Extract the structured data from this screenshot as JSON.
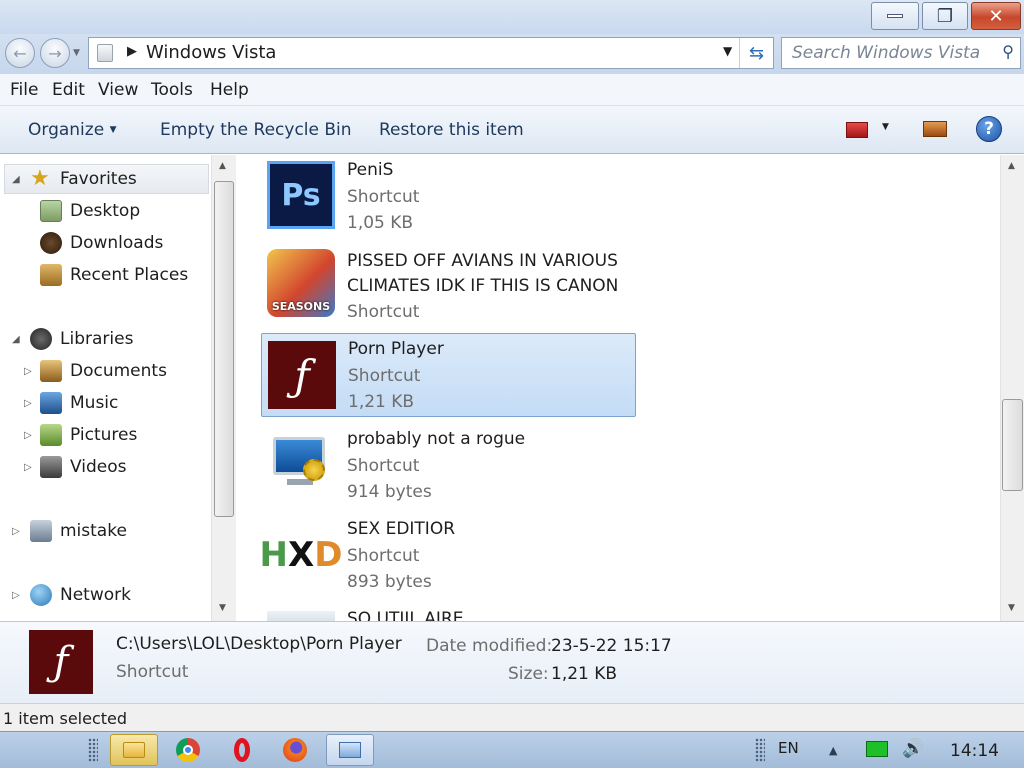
{
  "window": {
    "minimize_glyph": "—",
    "restore_glyph": "❐",
    "close_glyph": "✕"
  },
  "address": {
    "path": "Windows Vista",
    "search_placeholder": "Search Windows Vista"
  },
  "menu": [
    "File",
    "Edit",
    "View",
    "Tools",
    "Help"
  ],
  "toolbar": {
    "organize": "Organize",
    "empty": "Empty the Recycle Bin",
    "restore": "Restore this item",
    "help": "?"
  },
  "nav": {
    "favorites": "Favorites",
    "desktop": "Desktop",
    "downloads": "Downloads",
    "recent": "Recent Places",
    "libraries": "Libraries",
    "documents": "Documents",
    "music": "Music",
    "pictures": "Pictures",
    "videos": "Videos",
    "mistake": "mistake",
    "network": "Network"
  },
  "files": [
    {
      "name": "PeniS",
      "type": "Shortcut",
      "size": "1,05 KB",
      "icon": "photoshop-icon"
    },
    {
      "name": "PISSED OFF AVIANS IN VARIOUS",
      "name2": "CLIMATES IDK IF THIS IS CANON",
      "type": "Shortcut",
      "icon": "angry-birds-seasons-icon",
      "icon_text": "SEASONS"
    },
    {
      "name": "Porn Player",
      "type": "Shortcut",
      "size": "1,21 KB",
      "icon": "flash-player-icon"
    },
    {
      "name": "probably not a rogue",
      "type": "Shortcut",
      "size": "914 bytes",
      "icon": "computer-settings-icon"
    },
    {
      "name": "SEX EDITIOR",
      "type": "Shortcut",
      "size": "893 bytes",
      "icon": "hxd-icon"
    },
    {
      "name": "SO UTIIL AIRE"
    }
  ],
  "details": {
    "path": "C:\\Users\\LOL\\Desktop\\Porn Player",
    "type": "Shortcut",
    "date_label": "Date modified:",
    "date_value": "23-5-22 15:17",
    "size_label": "Size:",
    "size_value": "1,21 KB"
  },
  "status": "1 item selected",
  "tray": {
    "lang": "EN",
    "time": "14:14"
  },
  "colors": {
    "selection": "#cce0f7",
    "flash_bg": "#5a0a0a",
    "photoshop_bg": "#0b1a45"
  }
}
